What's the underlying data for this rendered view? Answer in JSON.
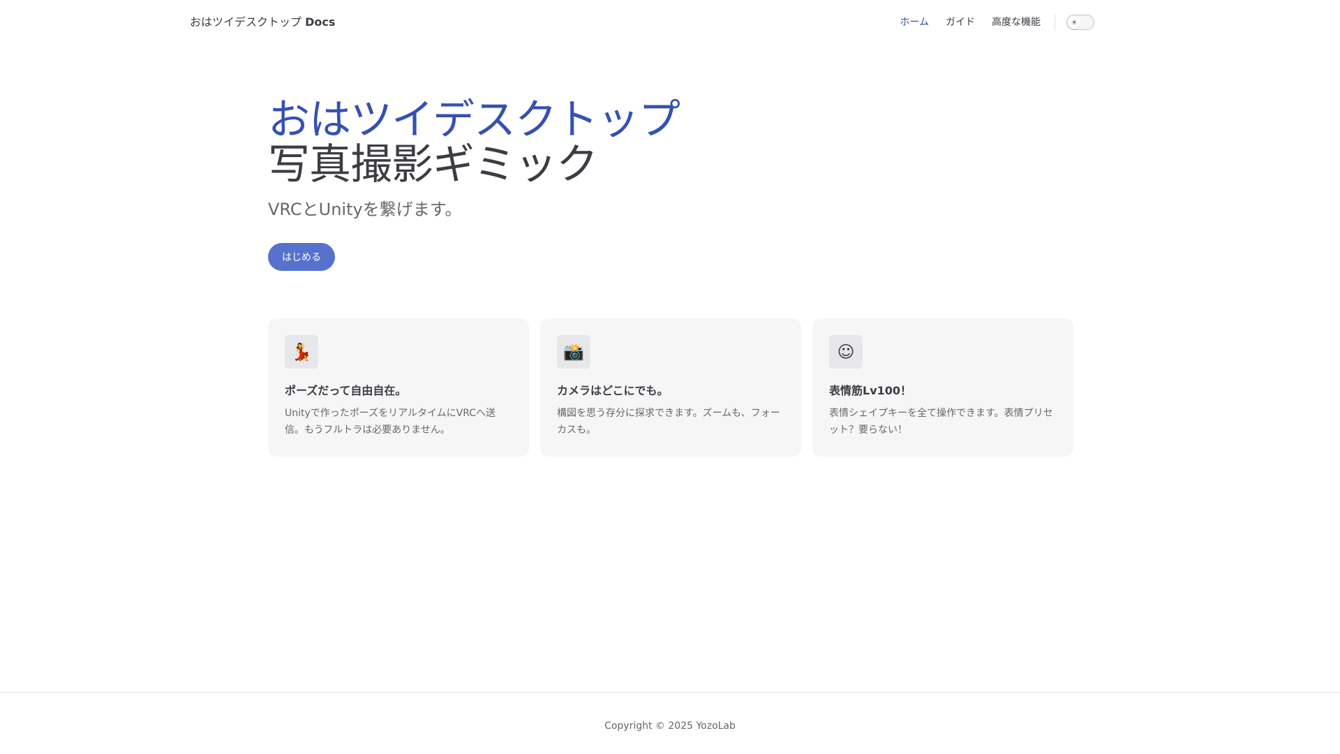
{
  "navbar": {
    "brand_prefix": "おはツイデスクトップ",
    "brand_suffix": "Docs",
    "links": [
      {
        "label": "ホーム"
      },
      {
        "label": "ガイド"
      },
      {
        "label": "高度な機能"
      }
    ],
    "theme_icon": "sun-icon",
    "theme_glyph": "☀"
  },
  "hero": {
    "name": "おはツイデスクトップ",
    "text": "写真撮影ギミック",
    "tagline": "VRCとUnityを繋げます。",
    "action_label": "はじめる"
  },
  "features": [
    {
      "icon": "💃",
      "title": "ポーズだって自由自在。",
      "details": "Unityで作ったポーズをリアルタイムにVRCへ送信。もうフルトラは必要ありません。"
    },
    {
      "icon": "📸",
      "title": "カメラはどこにでも。",
      "details": "構図を思う存分に探求できます。ズームも、フォーカスも。"
    },
    {
      "icon": "☺",
      "title": "表情筋Lv100！",
      "details": "表情シェイプキーを全て操作できます。表情プリセット？要らない！"
    }
  ],
  "footer": {
    "copyright": "Copyright © 2025 YozoLab"
  },
  "colors": {
    "brand": "#3451b2",
    "button": "#5672cd",
    "card_bg": "#f6f6f7",
    "text": "#3c3c43",
    "muted": "#67676c"
  }
}
